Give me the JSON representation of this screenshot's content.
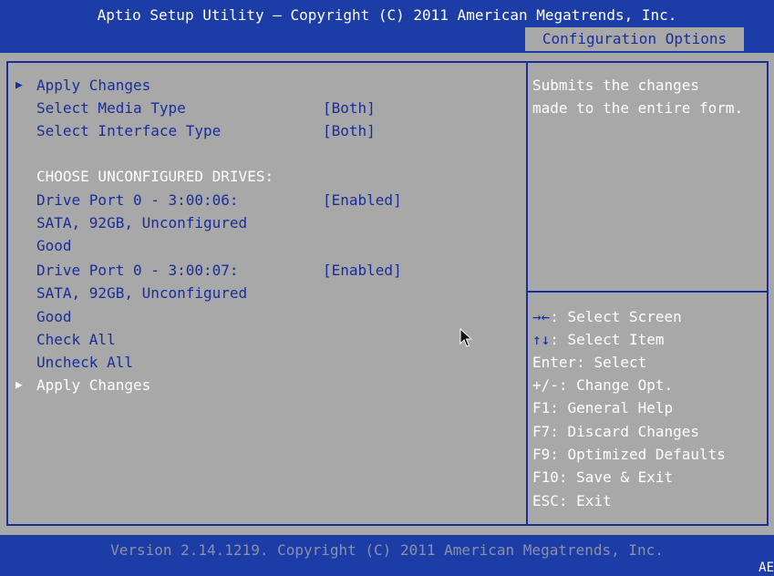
{
  "header": {
    "title": "Aptio Setup Utility – Copyright (C) 2011 American Megatrends, Inc.",
    "active_tab": "Configuration Options"
  },
  "menu": {
    "items": [
      {
        "label": "Apply Changes",
        "value": "",
        "arrow": true
      },
      {
        "label": "Select Media Type",
        "value": "[Both]"
      },
      {
        "label": "Select Interface Type",
        "value": "[Both]"
      },
      {
        "label": "CHOOSE UNCONFIGURED DRIVES:",
        "value": ""
      },
      {
        "label": "Drive Port 0 - 3:00:06:",
        "value": "[Enabled]"
      },
      {
        "label": "SATA, 92GB, Unconfigured",
        "value": ""
      },
      {
        "label": "Good",
        "value": ""
      },
      {
        "label": "Drive Port 0 - 3:00:07:",
        "value": "[Enabled]"
      },
      {
        "label": "SATA, 92GB, Unconfigured",
        "value": ""
      },
      {
        "label": "Good",
        "value": ""
      },
      {
        "label": "Check All",
        "value": ""
      },
      {
        "label": "Uncheck All",
        "value": ""
      },
      {
        "label": "Apply Changes",
        "value": "",
        "arrow": true,
        "selected": true
      }
    ]
  },
  "help": {
    "lines": [
      "Submits the changes",
      "made to the entire form."
    ]
  },
  "hints": [
    {
      "key": "→←",
      "desc": ": Select Screen"
    },
    {
      "key": "↑↓",
      "desc": ": Select Item"
    },
    {
      "key": "Enter",
      "desc": ": Select"
    },
    {
      "key": "+/-",
      "desc": ": Change Opt."
    },
    {
      "key": "F1",
      "desc": ": General Help"
    },
    {
      "key": "F7",
      "desc": ": Discard Changes"
    },
    {
      "key": "F9",
      "desc": ": Optimized Defaults"
    },
    {
      "key": "F10",
      "desc": ": Save & Exit"
    },
    {
      "key": "ESC",
      "desc": ": Exit"
    }
  ],
  "footer": {
    "text": "Version 2.14.1219. Copyright (C) 2011 American Megatrends, Inc.",
    "corner": "AE"
  },
  "colors": {
    "background": "#a8a8a8",
    "bar": "#1d3da6",
    "accent": "#1a2e9a",
    "text_white": "#ffffff"
  },
  "icons": {
    "submenu_arrow": "triangle-right-icon",
    "pointer": "mouse-cursor-icon"
  }
}
